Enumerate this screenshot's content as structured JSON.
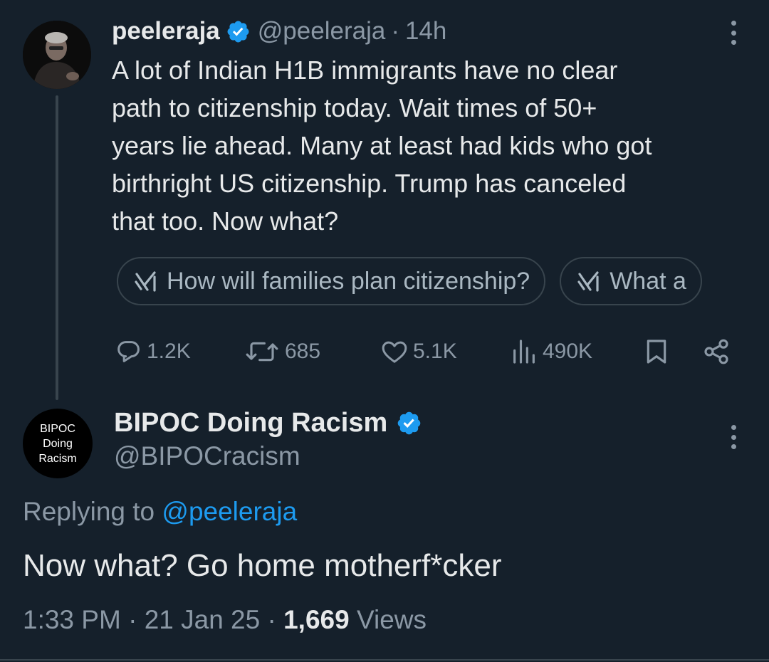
{
  "parent_tweet": {
    "display_name": "peeleraja",
    "handle": "@peeleraja",
    "separator": "·",
    "time": "14h",
    "text": "A lot of Indian H1B immigrants have no clear\npath to citizenship today. Wait times of 50+\nyears lie ahead. Many at least had kids who got\nbirthright US citizenship. Trump has canceled\nthat too. Now what?",
    "grok_prompts": [
      {
        "label": "How will families plan citizenship?"
      },
      {
        "label": "What a"
      }
    ],
    "actions": {
      "replies": "1.2K",
      "retweets": "685",
      "likes": "5.1K",
      "views": "490K"
    }
  },
  "reply_tweet": {
    "avatar_text": [
      "BIPOC",
      "Doing",
      "Racism"
    ],
    "display_name": "BIPOC Doing Racism",
    "handle": "@BIPOCracism",
    "replying_prefix": "Replying to",
    "replying_mention": "@peeleraja",
    "text": "Now what? Go home motherf*cker",
    "time": "1:33 PM",
    "separator": "·",
    "date": "21 Jan 25",
    "views_count": "1,669",
    "views_label": "Views"
  },
  "colors": {
    "background": "#15202b",
    "text_primary": "#e7e9ea",
    "text_secondary": "#8b98a5",
    "accent_blue": "#1d9bf0",
    "border": "#38444d"
  },
  "icons": [
    "verified-badge-icon",
    "more-options-icon",
    "grok-icon",
    "reply-icon",
    "retweet-icon",
    "like-icon",
    "views-icon",
    "bookmark-icon",
    "share-icon"
  ]
}
